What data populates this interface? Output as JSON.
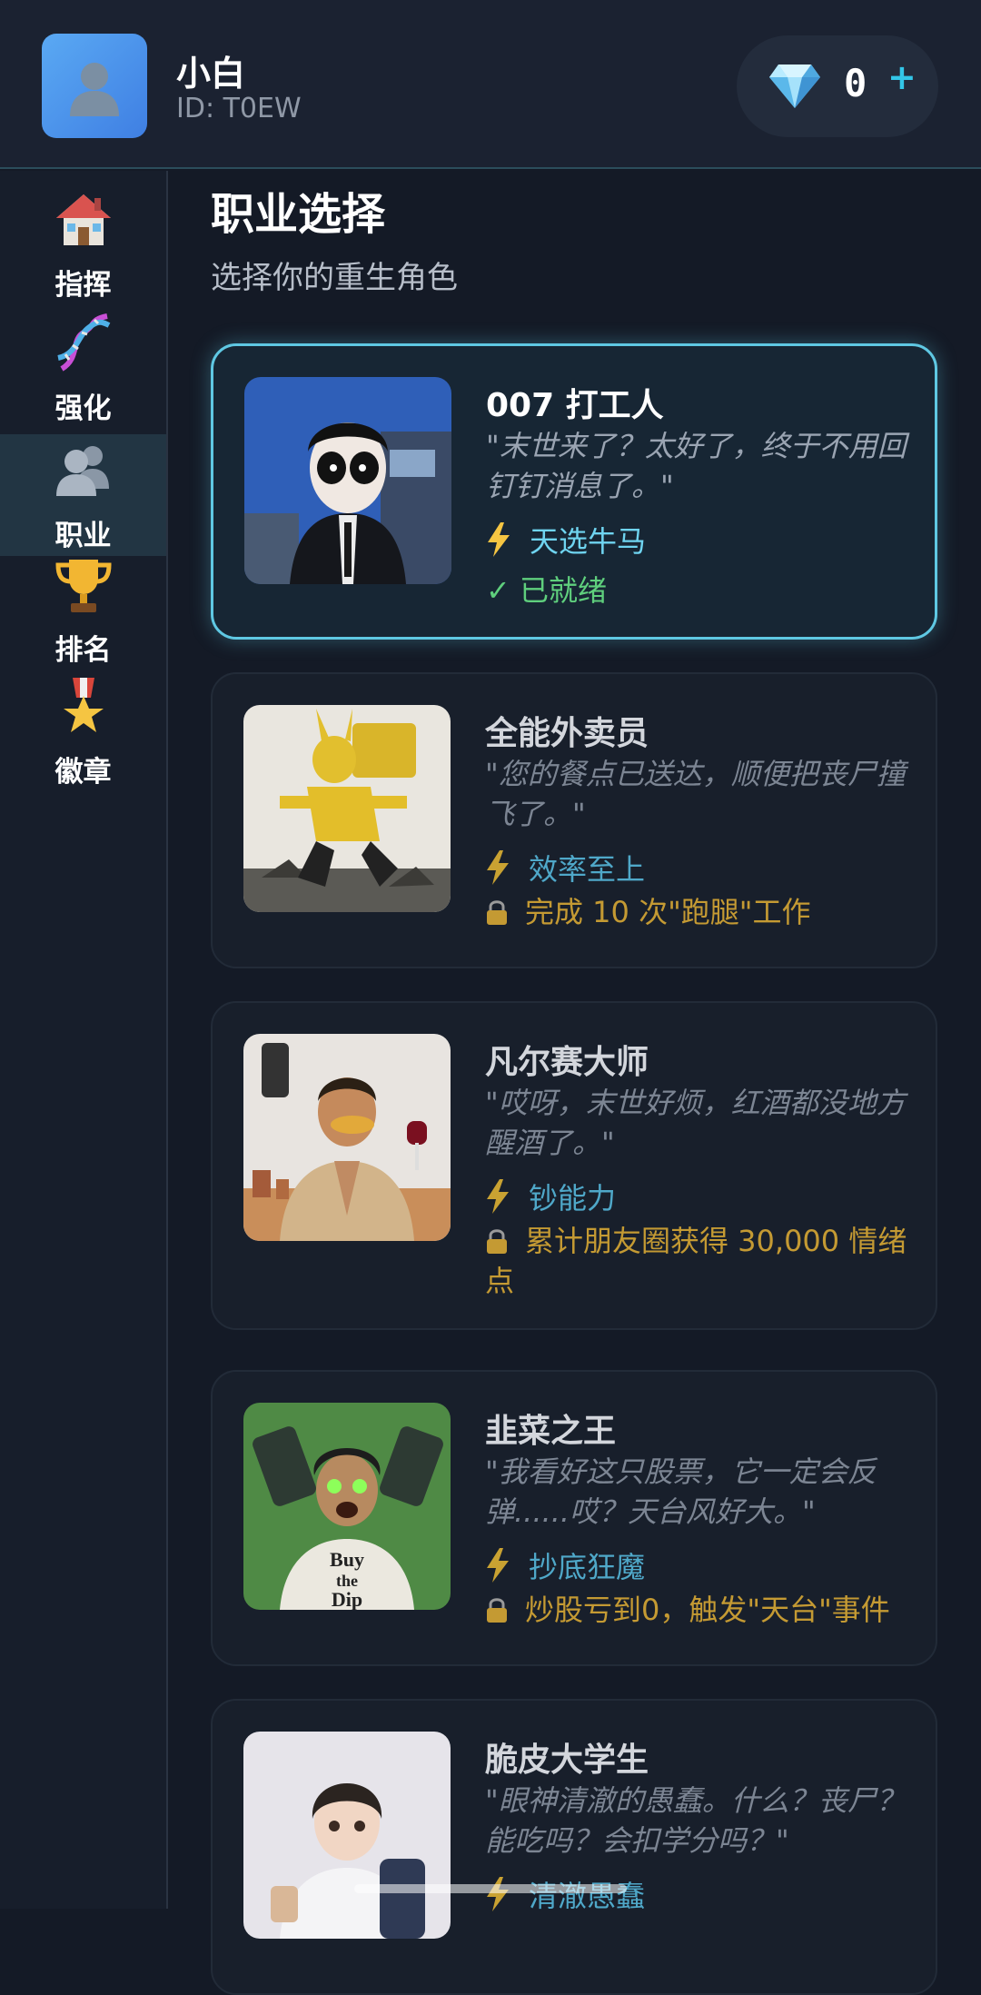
{
  "header": {
    "username": "小白",
    "user_id": "ID: T0EW",
    "gem_count": "0",
    "gem_plus": "+"
  },
  "sidebar": {
    "items": [
      {
        "label": "指挥",
        "icon": "house-icon"
      },
      {
        "label": "强化",
        "icon": "dna-icon"
      },
      {
        "label": "职业",
        "icon": "people-icon",
        "active": true
      },
      {
        "label": "排名",
        "icon": "trophy-icon"
      },
      {
        "label": "徽章",
        "icon": "medal-icon"
      }
    ]
  },
  "main": {
    "title": "职业选择",
    "subtitle": "选择你的重生角色",
    "cards": [
      {
        "title": "007 打工人",
        "quote": "\"末世来了？太好了，终于不用回钉钉消息了。\"",
        "skill": "天选牛马",
        "status": "✓ 已就绪",
        "selected": true
      },
      {
        "title": "全能外卖员",
        "quote": "\"您的餐点已送达，顺便把丧尸撞飞了。\"",
        "skill": "效率至上",
        "lock": "完成 10 次\"跑腿\"工作"
      },
      {
        "title": "凡尔赛大师",
        "quote": "\"哎呀，末世好烦，红酒都没地方醒酒了。\"",
        "skill": "钞能力",
        "lock": "累计朋友圈获得 30,000 情绪点"
      },
      {
        "title": "韭菜之王",
        "quote": "\"我看好这只股票，它一定会反弹......哎？天台风好大。\"",
        "skill": "抄底狂魔",
        "lock": "炒股亏到0，触发\"天台\"事件"
      },
      {
        "title": "脆皮大学生",
        "quote": "\"眼神清澈的愚蠢。什么？丧尸？能吃吗？会扣学分吗？\"",
        "skill": "清澈愚蠢"
      }
    ]
  },
  "colors": {
    "accent": "#5fc8e3",
    "ready": "#5fcf7d",
    "lock": "#c49a33",
    "skill": "#4fa8c9"
  }
}
